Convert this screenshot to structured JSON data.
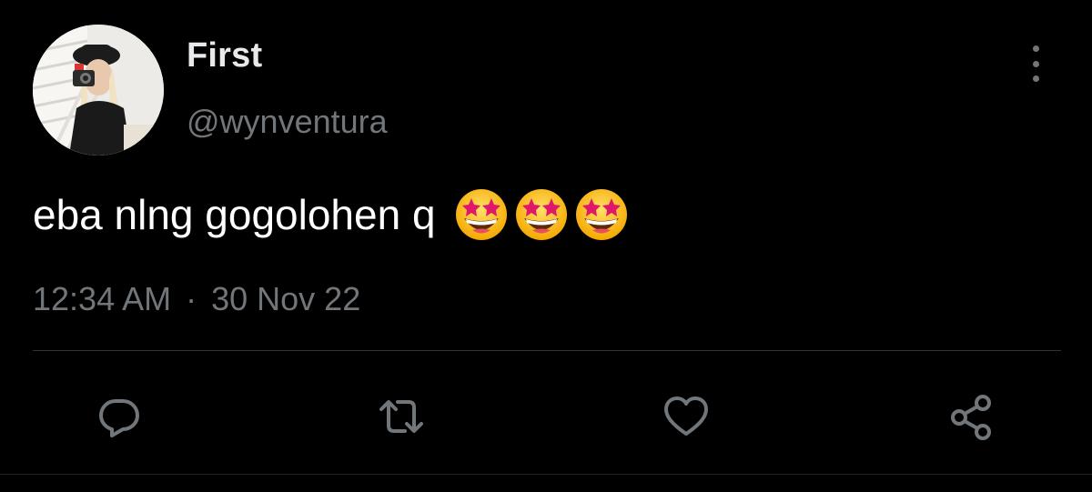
{
  "tweet": {
    "display_name": "First",
    "handle": "@wynventura",
    "text": "eba nlng gogolohen q",
    "emojis": [
      "star-struck-emoji",
      "star-struck-emoji",
      "star-struck-emoji"
    ],
    "time": "12:34 AM",
    "separator": "·",
    "date": "30 Nov 22"
  },
  "icons": {
    "more": "more-vertical-icon",
    "reply": "reply-icon",
    "retweet": "retweet-icon",
    "like": "heart-icon",
    "share": "share-icon"
  },
  "colors": {
    "background": "#000000",
    "primary_text": "#e7e9ea",
    "secondary_text": "#71767b",
    "divider": "#2f3336"
  }
}
